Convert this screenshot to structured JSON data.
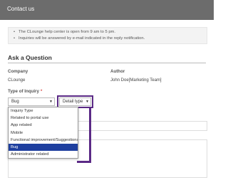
{
  "header": {
    "title": "Contact us"
  },
  "notice": {
    "lines": [
      "The CLounge help center is open from 9 am to 5 pm.",
      "Inquiries will be answered by e-mail indicated in the reply notification."
    ]
  },
  "section": {
    "heading": "Ask a Question"
  },
  "fields": {
    "company_label": "Company",
    "company_value": "CLounge",
    "author_label": "Author",
    "author_value": "John Doe[Marketing Team]",
    "type_label": "Type of Inquiry",
    "required_mark": "*"
  },
  "inquiry_select": {
    "value": "Bug",
    "caret": "▼"
  },
  "detail_select": {
    "value": "Detail type",
    "caret": "▼"
  },
  "dropdown": {
    "options": [
      "Inquiry Type",
      "Related to portal use",
      "App related",
      "Mobile",
      "Functional improvement/Suggestions",
      "Bug",
      "Administrator related"
    ],
    "selected_index": 5
  },
  "colors": {
    "header_bg": "#6c6c6c",
    "highlight": "#5b2a86",
    "selected_bg": "#1e3f9f"
  }
}
